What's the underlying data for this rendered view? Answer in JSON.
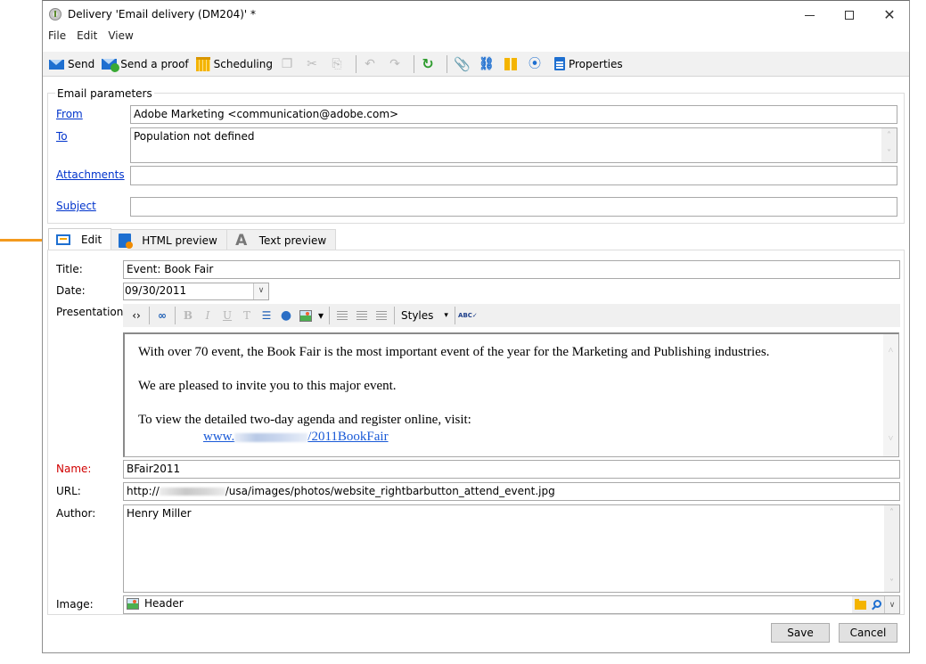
{
  "window": {
    "title": "Delivery 'Email delivery (DM204)' *",
    "controls": {
      "minimize": "minimize",
      "maximize": "maximize",
      "close": "✕"
    }
  },
  "menu": [
    "File",
    "Edit",
    "View"
  ],
  "toolbar": {
    "send": "Send",
    "send_proof": "Send a proof",
    "scheduling": "Scheduling",
    "properties": "Properties",
    "icons": {
      "copy": "copy-icon",
      "cut": "✂",
      "paste": "paste-icon",
      "undo": "↶",
      "redo": "↷",
      "refresh": "↻",
      "attach": "📎",
      "link": "⛓",
      "gauge": "⦿"
    }
  },
  "email_params": {
    "legend": "Email parameters",
    "from_label": "From",
    "from_value": "Adobe Marketing <communication@adobe.com>",
    "to_label": "To",
    "to_value": "Population not defined",
    "attachments_label": "Attachments",
    "attachments_value": "",
    "subject_label": "Subject",
    "subject_value": ""
  },
  "tabs": [
    {
      "label": "Edit",
      "active": true
    },
    {
      "label": "HTML preview",
      "active": false
    },
    {
      "label": "Text preview",
      "active": false
    }
  ],
  "edit": {
    "title_label": "Title:",
    "title_value": "Event: Book Fair",
    "date_label": "Date:",
    "date_value": "09/30/2011",
    "presentation_label": "Presentation:",
    "editor_toolbar": {
      "bold": "B",
      "italic": "I",
      "underline": "U",
      "clear": "T",
      "styles": "Styles",
      "caret": "▾",
      "spell": "ABC✓"
    },
    "content": {
      "p1": "With over 70 event, the Book Fair is the most important event of the year for the Marketing and Publishing industries.",
      "p2": "We are pleased to invite you to this major event.",
      "p3": "To view the detailed two-day agenda and register online, visit:",
      "link_prefix": "www.",
      "link_suffix": "/2011BookFair"
    },
    "name_label": "Name:",
    "name_value": "BFair2011",
    "url_label": "URL:",
    "url_prefix": "http://",
    "url_suffix": "/usa/images/photos/website_rightbarbutton_attend_event.jpg",
    "author_label": "Author:",
    "author_value": "Henry Miller",
    "image_label": "Image:",
    "image_value": "Header"
  },
  "buttons": {
    "save": "Save",
    "cancel": "Cancel"
  },
  "scroll": {
    "up": "˄",
    "down": "˅"
  },
  "dropdown_caret": "∨",
  "annotation": {
    "arrow_color": "#f39a1e",
    "points_to": "Edit tab"
  }
}
